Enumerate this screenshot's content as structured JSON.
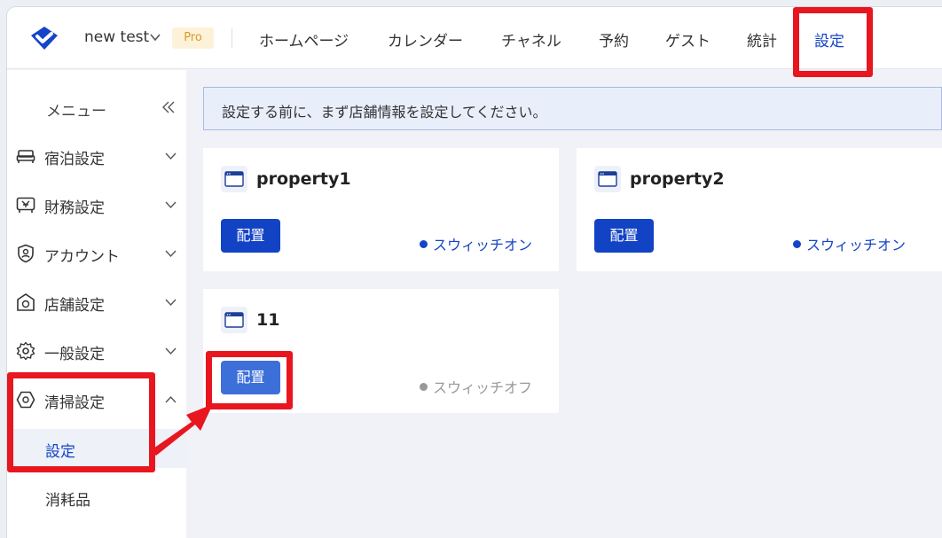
{
  "header": {
    "app_name": "new test",
    "pro_badge": "Pro",
    "nav": [
      "ホームページ",
      "カレンダー",
      "チャネル",
      "予約",
      "ゲスト",
      "統計",
      "設定"
    ],
    "active_nav": "設定"
  },
  "sidebar": {
    "menu_title": "メニュー",
    "items": [
      {
        "label": "宿泊設定",
        "icon": "bed-icon",
        "expanded": false
      },
      {
        "label": "財務設定",
        "icon": "finance-icon",
        "expanded": false
      },
      {
        "label": "アカウント",
        "icon": "account-shield-icon",
        "expanded": false
      },
      {
        "label": "店舗設定",
        "icon": "store-icon",
        "expanded": false
      },
      {
        "label": "一般設定",
        "icon": "gear-icon",
        "expanded": false
      },
      {
        "label": "清掃設定",
        "icon": "cleaning-icon",
        "expanded": true
      }
    ],
    "sub_items": [
      "設定",
      "消耗品"
    ],
    "active_sub_item": "設定"
  },
  "notice": {
    "text": "設定する前に、まず店舗情報を設定してください。"
  },
  "cards": [
    {
      "title": "property1",
      "button": "配置",
      "status": "スウィッチオン",
      "enabled": true
    },
    {
      "title": "property2",
      "button": "配置",
      "status": "スウィッチオン",
      "enabled": true
    },
    {
      "title": "11",
      "button": "配置",
      "status": "スウィッチオフ",
      "enabled": false
    }
  ],
  "colors": {
    "accent": "#1445c8",
    "button": "#1343c5",
    "annotation": "#e8161f",
    "pro_badge_bg": "#fdf2d9"
  }
}
